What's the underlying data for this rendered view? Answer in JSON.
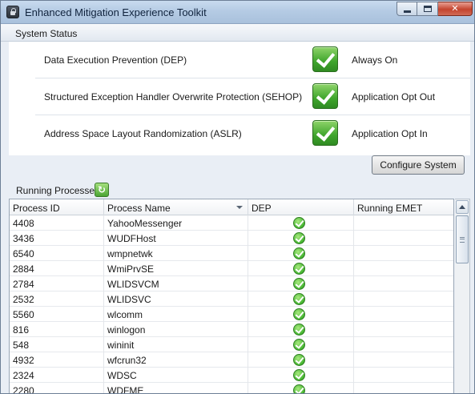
{
  "window": {
    "title": "Enhanced Mitigation Experience Toolkit",
    "close_label": "✕"
  },
  "system_status": {
    "header": "System Status",
    "rows": [
      {
        "label": "Data Execution Prevention (DEP)",
        "value": "Always On",
        "icon": "check-icon"
      },
      {
        "label": "Structured Exception Handler Overwrite Protection (SEHOP)",
        "value": "Application Opt Out",
        "icon": "check-icon"
      },
      {
        "label": "Address Space Layout Randomization (ASLR)",
        "value": "Application Opt In",
        "icon": "check-icon"
      }
    ],
    "configure_button": "Configure System"
  },
  "processes": {
    "title": "Running Processes",
    "refresh_icon": "↻",
    "columns": [
      "Process ID",
      "Process Name",
      "DEP",
      "Running EMET"
    ],
    "sorted_column": "Process Name",
    "rows": [
      {
        "pid": "4408",
        "name": "YahooMessenger",
        "dep": true,
        "emet": ""
      },
      {
        "pid": "3436",
        "name": "WUDFHost",
        "dep": true,
        "emet": ""
      },
      {
        "pid": "6540",
        "name": "wmpnetwk",
        "dep": true,
        "emet": ""
      },
      {
        "pid": "2884",
        "name": "WmiPrvSE",
        "dep": true,
        "emet": ""
      },
      {
        "pid": "2784",
        "name": "WLIDSVCM",
        "dep": true,
        "emet": ""
      },
      {
        "pid": "2532",
        "name": "WLIDSVC",
        "dep": true,
        "emet": ""
      },
      {
        "pid": "5560",
        "name": "wlcomm",
        "dep": true,
        "emet": ""
      },
      {
        "pid": "816",
        "name": "winlogon",
        "dep": true,
        "emet": ""
      },
      {
        "pid": "548",
        "name": "wininit",
        "dep": true,
        "emet": ""
      },
      {
        "pid": "4932",
        "name": "wfcrun32",
        "dep": true,
        "emet": ""
      },
      {
        "pid": "2324",
        "name": "WDSC",
        "dep": true,
        "emet": ""
      },
      {
        "pid": "2280",
        "name": "WDFME",
        "dep": true,
        "emet": ""
      }
    ]
  },
  "colors": {
    "title_bar": "#b5cbe4",
    "check_green": "#3fa52c",
    "close_red": "#c4442e"
  }
}
